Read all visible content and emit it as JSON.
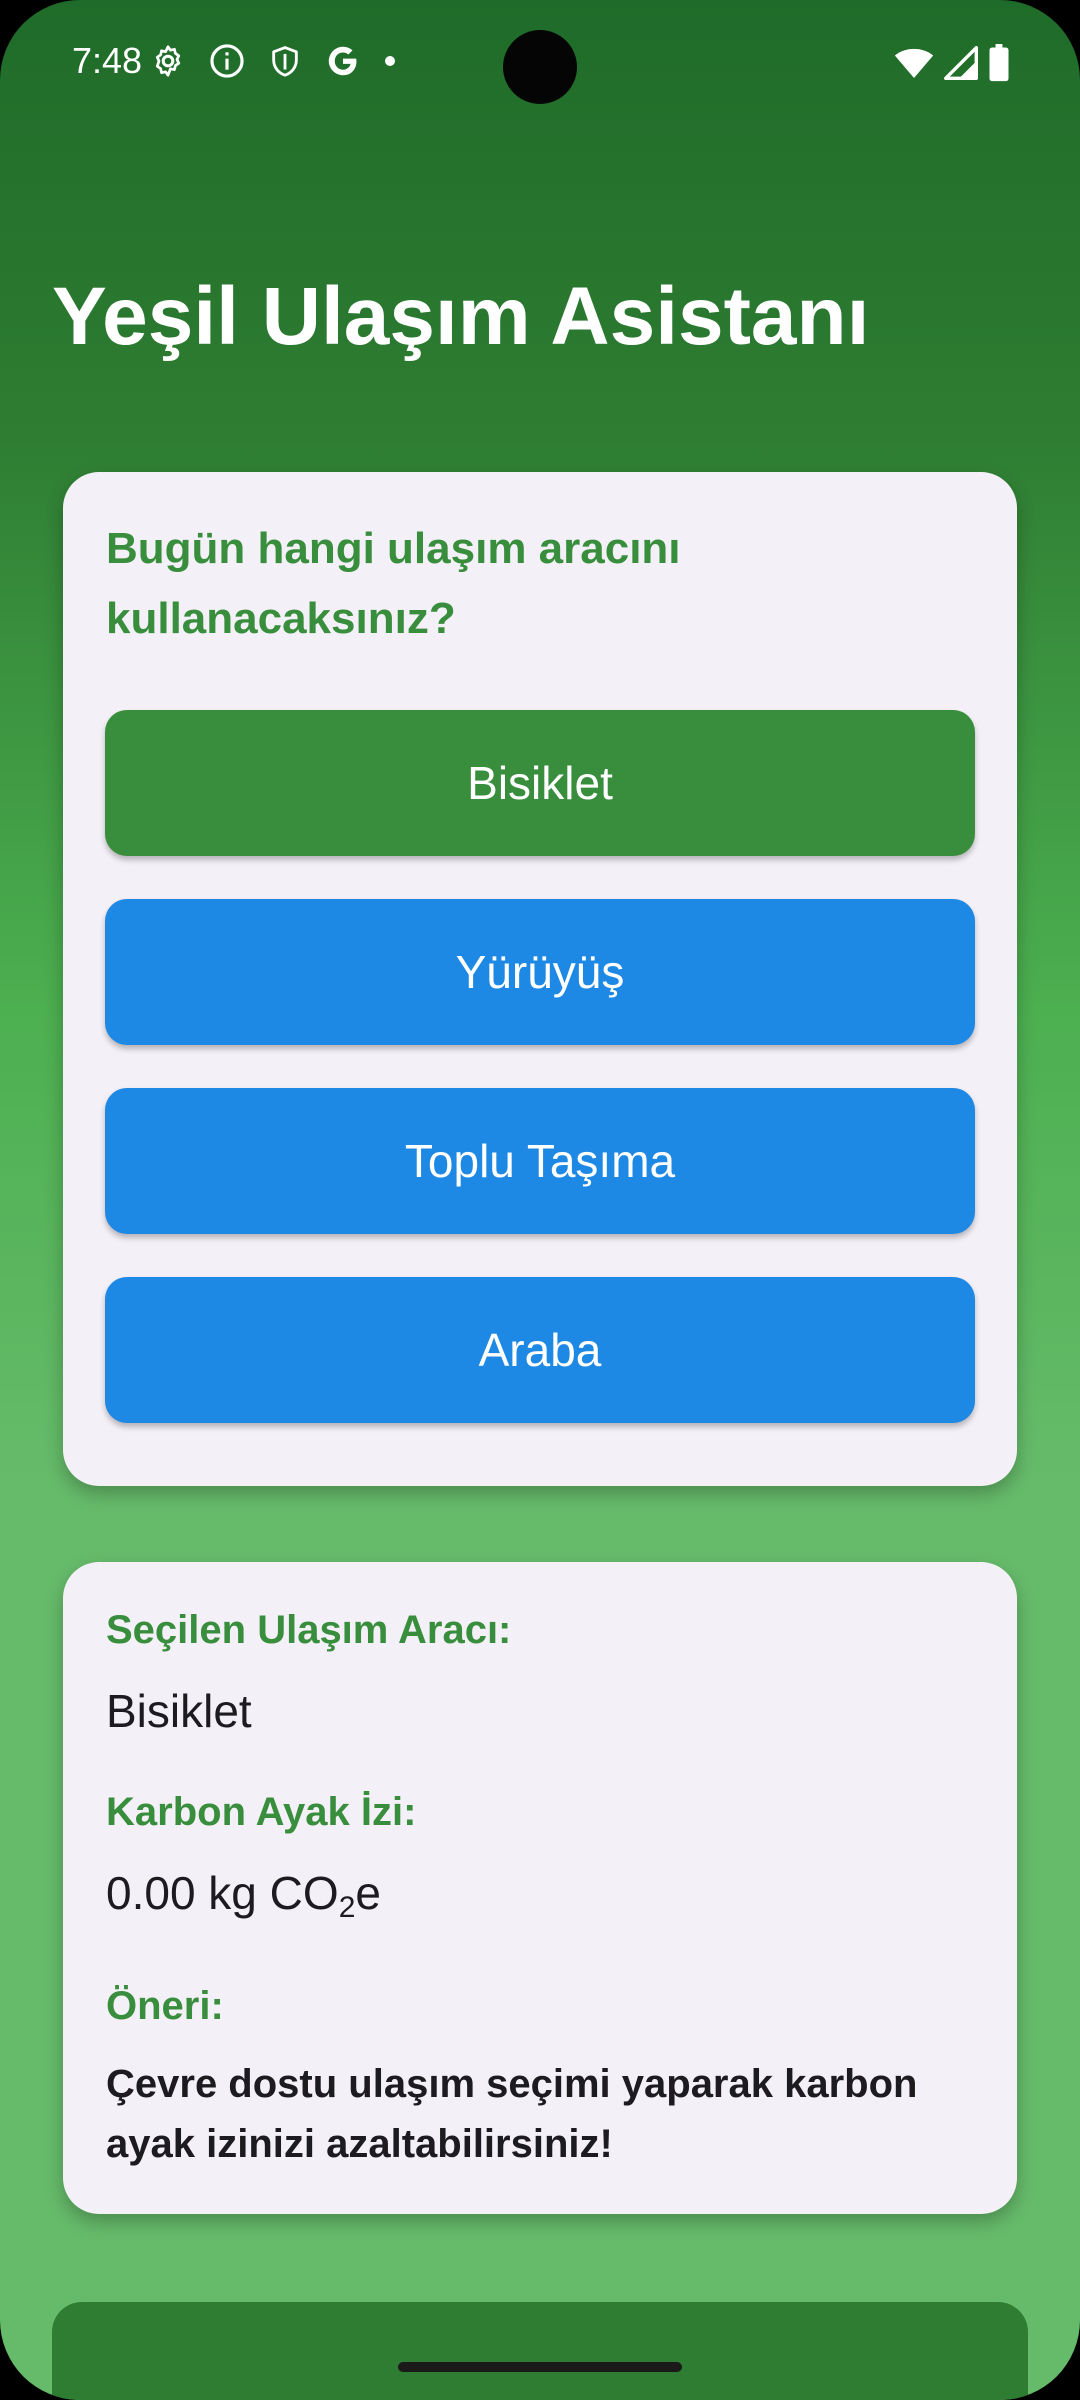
{
  "status_bar": {
    "time": "7:48",
    "left_icons": [
      "settings-icon",
      "info-icon",
      "shield-icon",
      "google-icon",
      "dot-icon"
    ],
    "right_icons": [
      "wifi-icon",
      "signal-icon",
      "battery-icon"
    ]
  },
  "app": {
    "title": "Yeşil Ulaşım Asistanı"
  },
  "choice_card": {
    "question": "Bugün hangi ulaşım aracını kullanacaksınız?",
    "options": [
      {
        "label": "Bisiklet",
        "selected": true,
        "color": "#388e3c"
      },
      {
        "label": "Yürüyüş",
        "selected": false,
        "color": "#1e88e5"
      },
      {
        "label": "Toplu Taşıma",
        "selected": false,
        "color": "#1e88e5"
      },
      {
        "label": "Araba",
        "selected": false,
        "color": "#1e88e5"
      }
    ]
  },
  "result_card": {
    "selected_label": "Seçilen Ulaşım Aracı:",
    "selected_value": "Bisiklet",
    "footprint_label": "Karbon Ayak İzi:",
    "footprint_number": "0.00 kg CO",
    "footprint_sub": "2",
    "footprint_suffix": "e",
    "suggestion_label": "Öneri:",
    "suggestion_text": "Çevre dostu ulaşım seçimi yaparak karbon ayak izinizi azaltabilirsiniz!"
  },
  "colors": {
    "accent_green": "#388e3c",
    "button_blue": "#1e88e5",
    "card_background": "#f4f0f7"
  }
}
